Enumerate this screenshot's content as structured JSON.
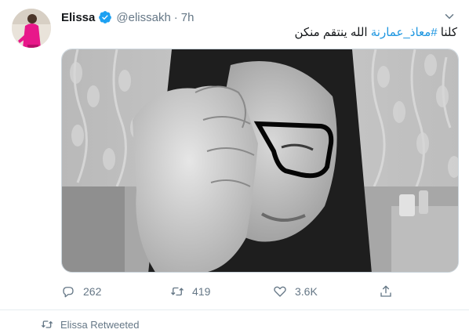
{
  "tweet": {
    "author_name": "Elissa",
    "handle": "@elissakh",
    "separator": "·",
    "time": "7h",
    "text_before": "كلنا ",
    "hashtag": "#معاذ_عمارنة",
    "text_after": " الله ينتقم منكن",
    "counts": {
      "replies": "262",
      "retweets": "419",
      "likes": "3.6K"
    },
    "icons": {
      "verified": "verified-badge-icon",
      "menu": "chevron-down-icon",
      "reply": "reply-icon",
      "retweet": "retweet-icon",
      "like": "heart-icon",
      "share": "share-icon"
    }
  },
  "footer": {
    "retweet_note": "Elissa Retweeted"
  },
  "colors": {
    "link": "#1b95e0",
    "muted": "#657786",
    "verified": "#1da1f2",
    "avatar_dress": "#e8178a"
  }
}
